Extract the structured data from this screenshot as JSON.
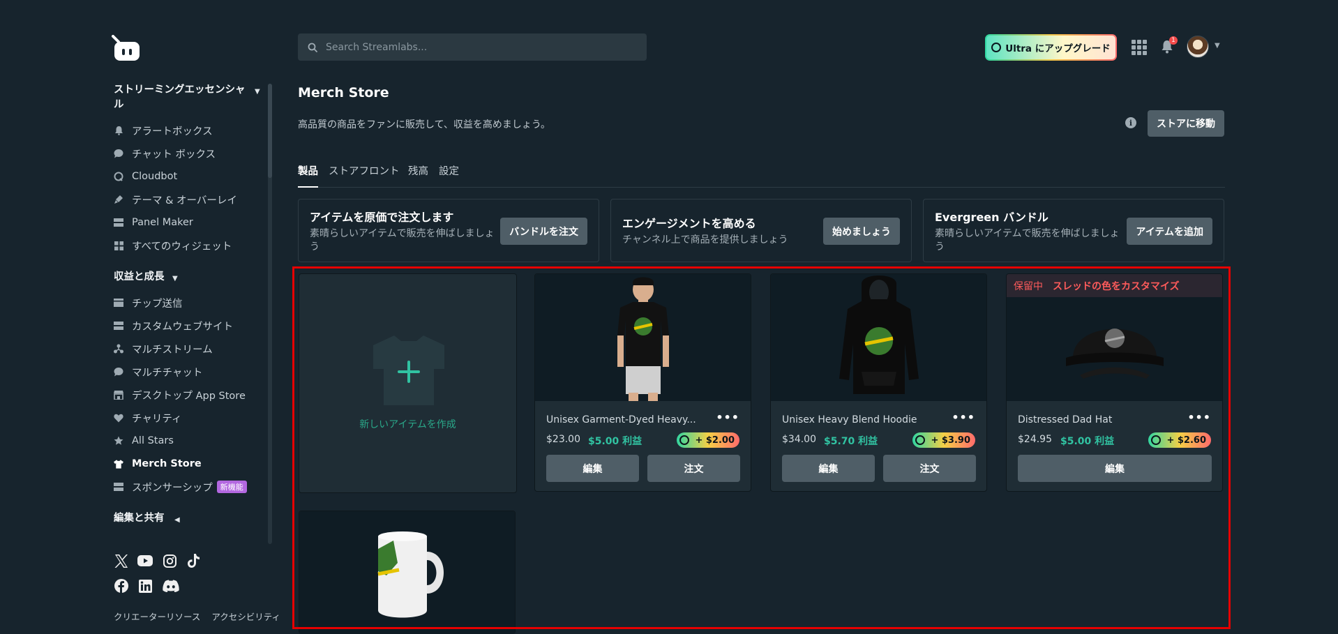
{
  "header": {
    "search_placeholder": "Search Streamlabs...",
    "ultra_label": "Ultra にアップグレード",
    "notification_count": "1"
  },
  "sidebar": {
    "section1_title": "ストリーミングエッセンシャル",
    "section1_items": [
      {
        "label": "アラートボックス",
        "icon": "bell-icon"
      },
      {
        "label": "チャット ボックス",
        "icon": "chat-bubble-icon"
      },
      {
        "label": "Cloudbot",
        "icon": "cloudbot-icon"
      },
      {
        "label": "テーマ & オーバーレイ",
        "icon": "paint-icon"
      },
      {
        "label": "Panel Maker",
        "icon": "panel-icon"
      },
      {
        "label": "すべてのウィジェット",
        "icon": "widgets-grid-icon"
      }
    ],
    "section2_title": "収益と成長",
    "section2_items": [
      {
        "label": "チップ送信",
        "icon": "tip-icon"
      },
      {
        "label": "カスタムウェブサイト",
        "icon": "website-icon"
      },
      {
        "label": "マルチストリーム",
        "icon": "multistream-icon"
      },
      {
        "label": "マルチチャット",
        "icon": "multichat-icon"
      },
      {
        "label": "デスクトップ App Store",
        "icon": "store-icon"
      },
      {
        "label": "チャリティ",
        "icon": "heart-icon"
      },
      {
        "label": "All Stars",
        "icon": "star-icon"
      },
      {
        "label": "Merch Store",
        "icon": "tshirt-icon",
        "active": true
      },
      {
        "label": "スポンサーシップ",
        "icon": "sponsorship-icon",
        "badge": "新機能"
      }
    ],
    "section3_title": "編集と共有",
    "footer_links": [
      "クリエーターリソース",
      "アクセシビリティ"
    ]
  },
  "main": {
    "title": "Merch Store",
    "description": "高品質の商品をファンに販売して、収益を高めましょう。",
    "store_button": "ストアに移動",
    "tabs": [
      "製品",
      "ストアフロント",
      "残高",
      "設定"
    ],
    "promos": [
      {
        "title": "アイテムを原価で注文します",
        "subtitle": "素晴らしいアイテムで販売を伸ばしましょう",
        "button": "バンドルを注文"
      },
      {
        "title": "エンゲージメントを高める",
        "subtitle": "チャンネル上で商品を提供しましょう",
        "button": "始めましょう"
      },
      {
        "title": "Evergreen バンドル",
        "subtitle": "素晴らしいアイテムで販売を伸ばしましょう",
        "button": "アイテムを追加"
      }
    ],
    "create_label": "新しいアイテムを作成",
    "products": [
      {
        "name": "Unisex Garment-Dyed Heavy...",
        "price": "$23.00",
        "profit": "$5.00 利益",
        "boost": "+ $2.00",
        "edit": "編集",
        "order": "注文"
      },
      {
        "name": "Unisex Heavy Blend Hoodie",
        "price": "$34.00",
        "profit": "$5.70 利益",
        "boost": "+ $3.90",
        "edit": "編集",
        "order": "注文"
      },
      {
        "name": "Distressed Dad Hat",
        "price": "$24.95",
        "profit": "$5.00 利益",
        "boost": "+ $2.60",
        "edit": "編集",
        "hold": "保留中",
        "customize": "スレッドの色をカスタマイズ"
      }
    ]
  },
  "colors": {
    "accent": "#31c3a2",
    "background": "#17242d",
    "card": "#1f2d35",
    "button": "#4f5e67",
    "highlight": "#e60000"
  }
}
